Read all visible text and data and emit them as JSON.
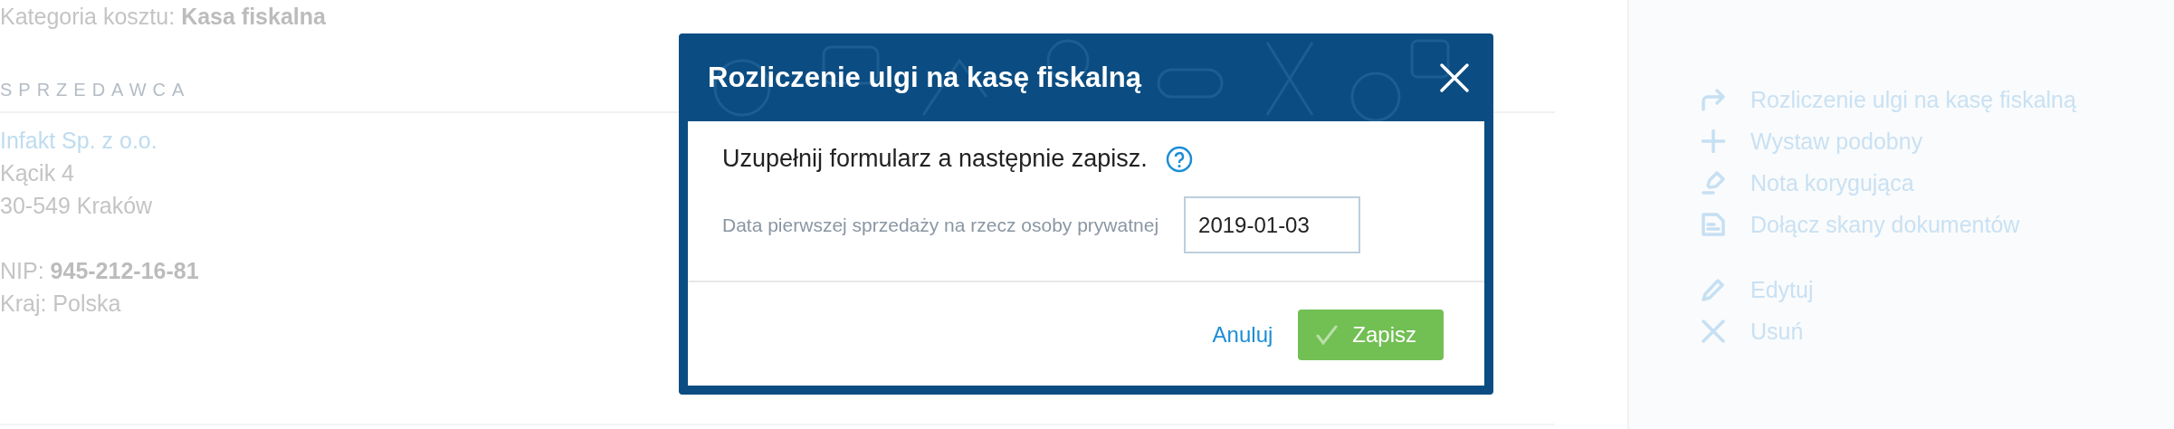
{
  "details": {
    "cost_category": "Kategoria kosztu: **Kasa fiskalna**",
    "seller_heading": "SPRZEDAWCA",
    "seller": {
      "name": "Infakt Sp. z o.o.",
      "street": "Kącik 4",
      "city": "30-549 Kraków",
      "tax_id": "NIP: **945-212-16-81**",
      "country": "Kraj: Polska"
    }
  },
  "sidebar": {
    "groups": [
      [
        {
          "kind": "redo",
          "label": "Rozliczenie ulgi na kasę fiskalną"
        },
        {
          "kind": "plus",
          "label": "Wystaw podobny"
        },
        {
          "kind": "note",
          "label": "Nota korygująca"
        },
        {
          "kind": "scan",
          "label": "Dołącz skany dokumentów"
        }
      ],
      [
        {
          "kind": "edit",
          "label": "Edytuj"
        },
        {
          "kind": "delete",
          "label": "Usuń"
        }
      ]
    ]
  },
  "dialog": {
    "title": "Rozliczenie ulgi na kasę fiskalną",
    "intro": "Uzupełnij formularz a następnie zapisz.",
    "field": {
      "label": "Data pierwszej sprzedaży na rzecz osoby prywatnej",
      "value": "2019-01-03"
    },
    "buttons": [
      {
        "kind": "link",
        "label": "Anuluj"
      },
      {
        "kind": "primary",
        "label": "Zapisz"
      }
    ]
  }
}
